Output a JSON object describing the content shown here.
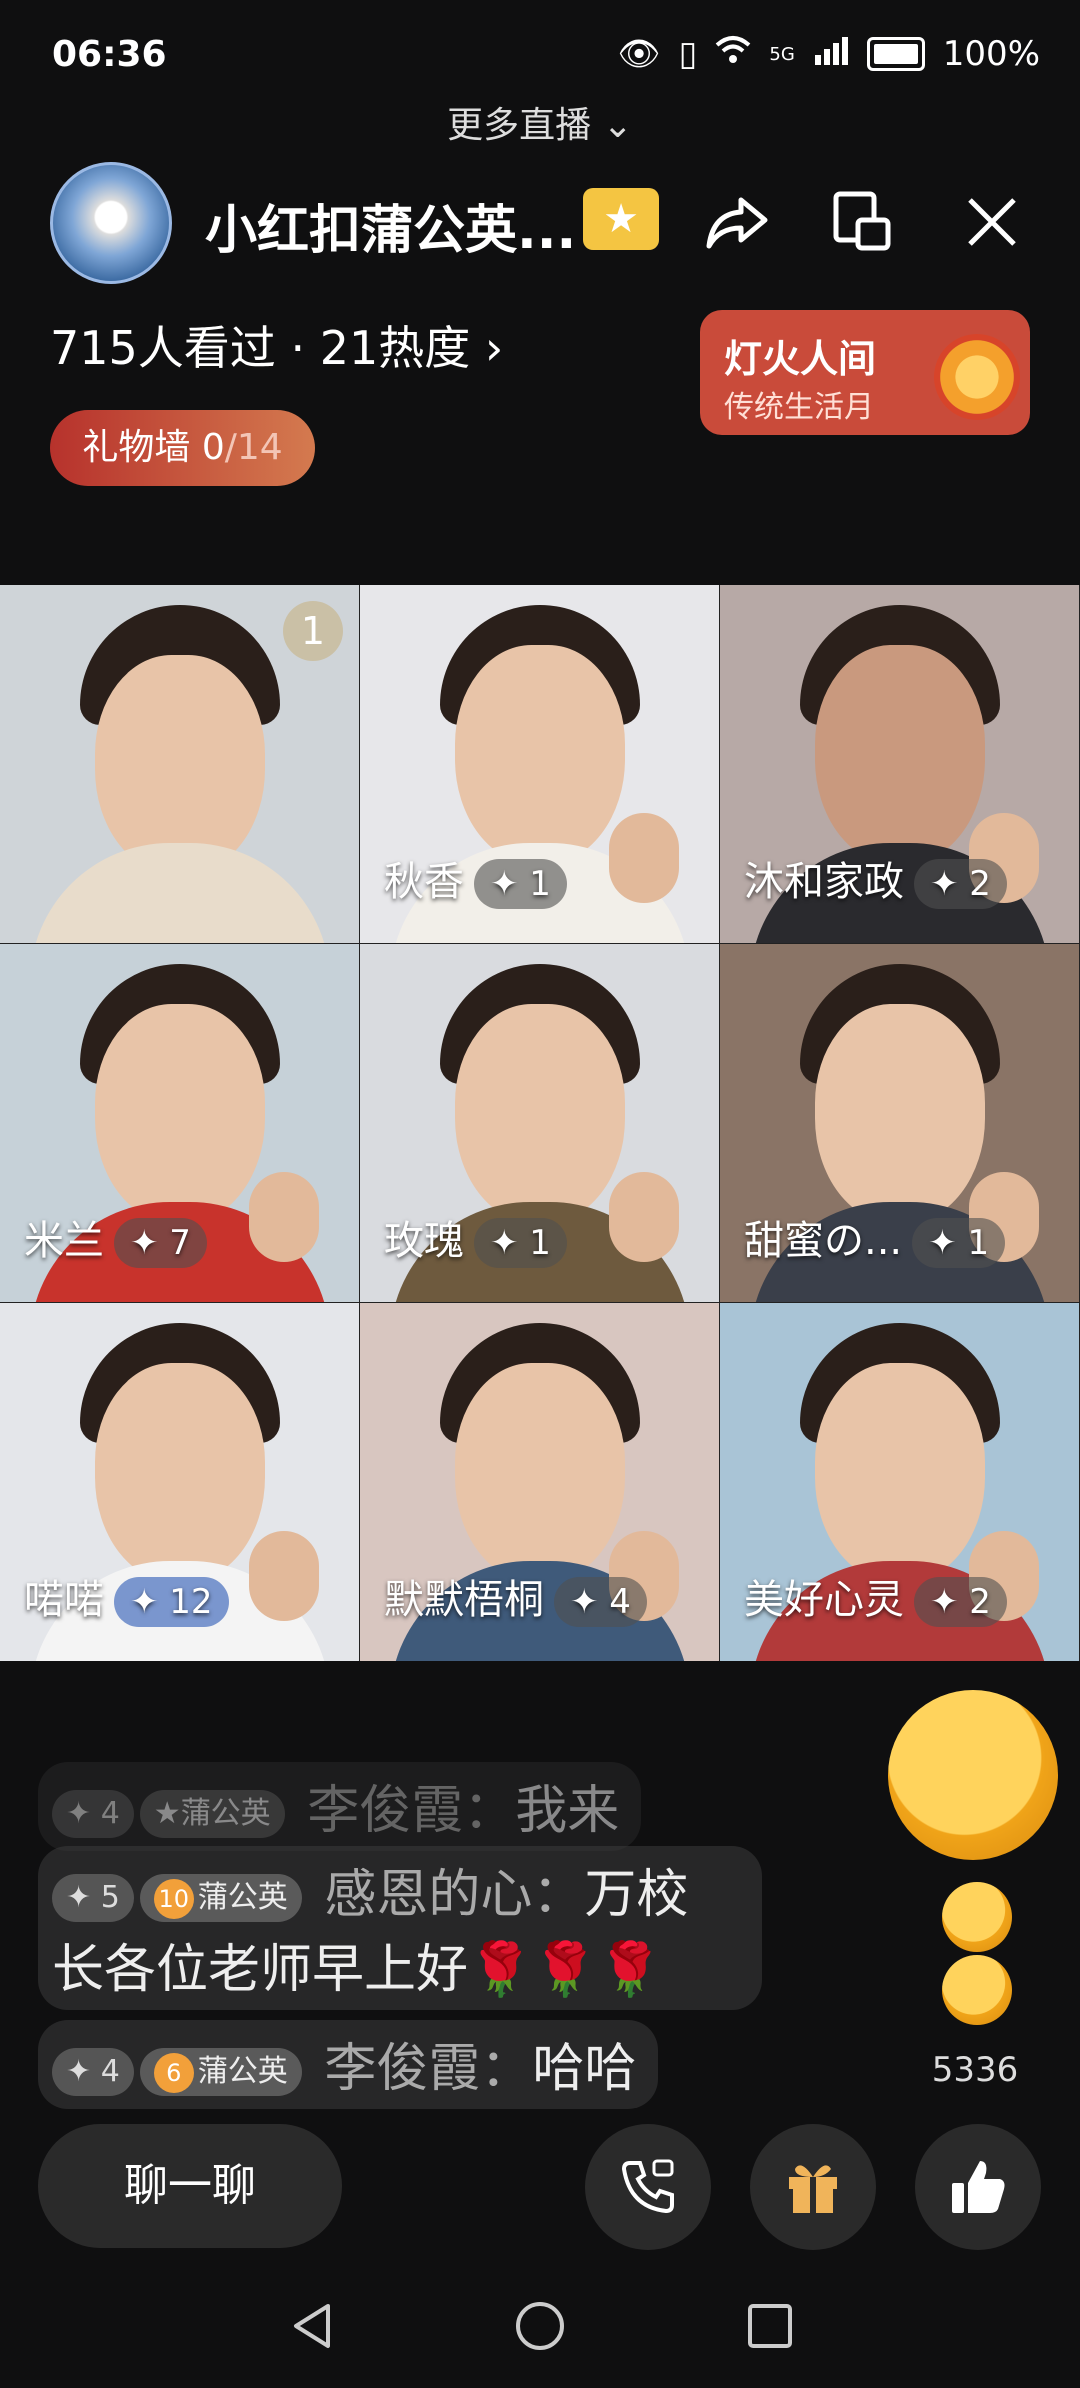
{
  "status_bar": {
    "time": "06:36",
    "network": "5G",
    "battery": "100%"
  },
  "header": {
    "more_live": "更多直播",
    "room_title": "小红扣蒲公英...",
    "viewers": "715人看过",
    "heat": "21热度"
  },
  "event_banner": {
    "title": "灯火人间",
    "subtitle": "传统生活月"
  },
  "gift_wall": {
    "label": "礼物墙",
    "current": "0",
    "total": "/14"
  },
  "tiles": [
    {
      "name": "",
      "rank": "1",
      "score": ""
    },
    {
      "name": "秋香",
      "score": "1"
    },
    {
      "name": "沐和家政",
      "score": "2"
    },
    {
      "name": "米兰",
      "score": "7"
    },
    {
      "name": "玫瑰",
      "score": "1"
    },
    {
      "name": "甜蜜の...",
      "score": "1"
    },
    {
      "name": "喏喏",
      "score": "12"
    },
    {
      "name": "默默梧桐",
      "score": "4"
    },
    {
      "name": "美好心灵",
      "score": "2"
    }
  ],
  "comments": [
    {
      "badge": "4",
      "fan_level": "",
      "fan_label": "蒲公英",
      "user": "李俊霞：",
      "text": "我来"
    },
    {
      "badge": "5",
      "fan_level": "10",
      "fan_label": "蒲公英",
      "user": "感恩的心：",
      "text": "万校长各位老师早上好🌹🌹🌹"
    },
    {
      "badge": "4",
      "fan_level": "6",
      "fan_label": "蒲公英",
      "user": "李俊霞：",
      "text": "哈哈"
    }
  ],
  "likes": {
    "count": "5336"
  },
  "bottom_bar": {
    "chat_label": "聊一聊"
  },
  "colors": {
    "gift_wall": "#b7322c",
    "event_banner": "#c94b3a",
    "badge": "#f4c542"
  }
}
